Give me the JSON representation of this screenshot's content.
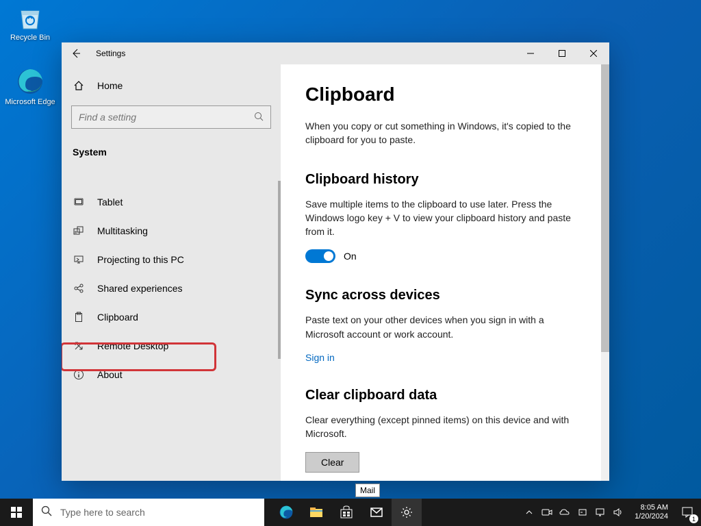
{
  "desktop": {
    "icons": [
      {
        "label": "Recycle Bin"
      },
      {
        "label": "Microsoft Edge"
      }
    ]
  },
  "window": {
    "title": "Settings",
    "sidebar": {
      "home_label": "Home",
      "search_placeholder": "Find a setting",
      "category": "System",
      "items": [
        {
          "label": "Tablet"
        },
        {
          "label": "Multitasking"
        },
        {
          "label": "Projecting to this PC"
        },
        {
          "label": "Shared experiences"
        },
        {
          "label": "Clipboard"
        },
        {
          "label": "Remote Desktop"
        },
        {
          "label": "About"
        }
      ]
    },
    "content": {
      "title": "Clipboard",
      "description": "When you copy or cut something in Windows, it's copied to the clipboard for you to paste.",
      "sections": {
        "history": {
          "title": "Clipboard history",
          "description": "Save multiple items to the clipboard to use later. Press the Windows logo key + V to view your clipboard history and paste from it.",
          "toggle_state": "On"
        },
        "sync": {
          "title": "Sync across devices",
          "description": "Paste text on your other devices when you sign in with a Microsoft account or work account.",
          "link": "Sign in"
        },
        "clear": {
          "title": "Clear clipboard data",
          "description": "Clear everything (except pinned items) on this device and with Microsoft.",
          "button": "Clear"
        }
      }
    }
  },
  "taskbar": {
    "search_placeholder": "Type here to search",
    "tooltip": "Mail",
    "clock": {
      "time": "8:05 AM",
      "date": "1/20/2024"
    },
    "notif_count": "1"
  }
}
